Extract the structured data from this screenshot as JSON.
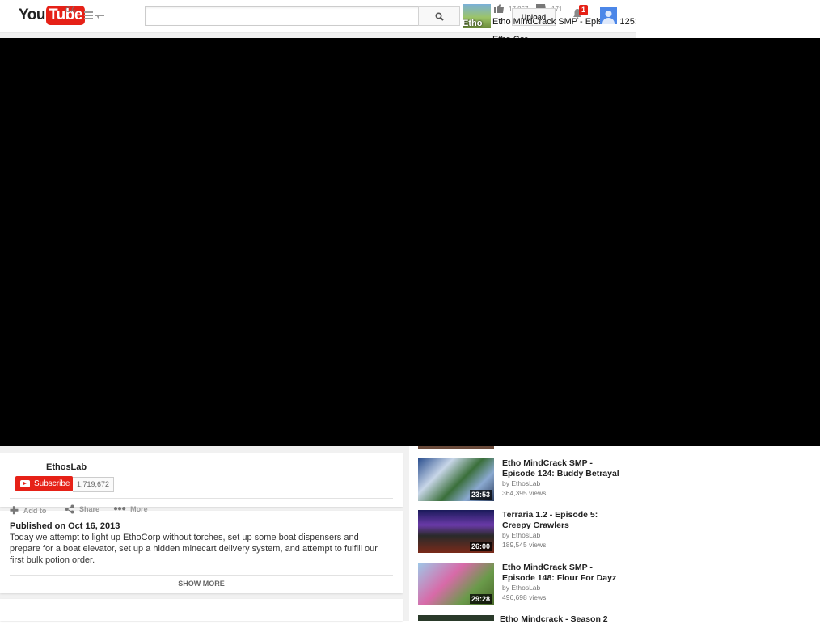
{
  "masthead": {
    "logo_you": "You",
    "logo_tube": "Tube",
    "country": "CA",
    "search_placeholder": "",
    "upload_label": "Upload",
    "notification_count": "1"
  },
  "video": {
    "title_line1": "Etho MindCrack SMP - Episode 125:",
    "title_line2": "Etho Cor",
    "thumb_text": "Etho",
    "likes": "17,867",
    "dislikes": "171"
  },
  "owner": {
    "channel_name": "EthosLab",
    "subscribe_label": "Subscribe",
    "subscriber_count": "1,719,672"
  },
  "actions": [
    {
      "label": "Add to",
      "icon": "plus-icon"
    },
    {
      "label": "Share",
      "icon": "share-icon"
    },
    {
      "label": "More",
      "icon": "more-icon"
    }
  ],
  "description": {
    "published": "Published on Oct 16, 2013",
    "text": "Today we attempt to light up EthoCorp without torches, set up some boat dispensers and prepare for a boat elevator, set up a hidden minecart delivery system, and attempt to fulfill our first bulk potion order.",
    "show_more": "SHOW MORE"
  },
  "related": [
    {
      "title": "Etho MindCrack SMP - Episode 124: Buddy Betrayal",
      "by": "by EthosLab",
      "views": "364,395 views",
      "duration": "23:53"
    },
    {
      "title": "Terraria 1.2 - Episode 5: Creepy Crawlers",
      "by": "by EthosLab",
      "views": "189,545 views",
      "duration": "26:00"
    },
    {
      "title": "Etho MindCrack SMP - Episode 148: Flour For Dayz",
      "by": "by EthosLab",
      "views": "496,698 views",
      "duration": "29:28"
    }
  ],
  "related_partial_title": "Etho Mindcrack - Season 2",
  "colors": {
    "brand_red": "#e62117",
    "player": "#000000"
  }
}
